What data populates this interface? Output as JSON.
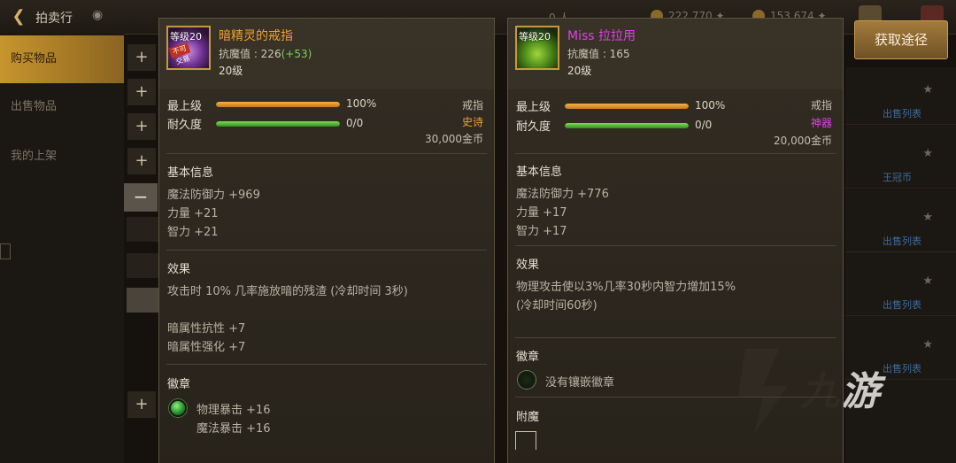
{
  "topbar": {
    "title": "拍卖行",
    "ghost1": "0 人",
    "ghost2": "222,770 ✦",
    "ghost3": "153,674 ✦"
  },
  "sidebar": {
    "items": [
      {
        "label": "购买物品"
      },
      {
        "label": "出售物品"
      },
      {
        "label": "我的上架"
      }
    ]
  },
  "obtain_button": {
    "label": "获取途径"
  },
  "right_list": {
    "items": [
      "出售列表",
      "王冠币",
      "出售列表",
      "出售列表",
      "出售列表"
    ]
  },
  "watermark": {
    "text": "九游"
  },
  "left_item": {
    "badge": "等级20",
    "lock": "不可交易",
    "name": "暗精灵的戒指",
    "name_color": "#f0a030",
    "stat_label": "抗魔值 : 226",
    "stat_bonus": "(+53)",
    "level": "20级",
    "bar1_label": "最上级",
    "bar1_value": "100%",
    "bar1_fill": 1.0,
    "bar2_label": "耐久度",
    "bar2_value": "0/0",
    "bar2_fill": 1.0,
    "type": "戒指",
    "rarity": "史诗",
    "rarity_color": "#f0a030",
    "price": "30,000金币",
    "basic_title": "基本信息",
    "basic": [
      "魔法防御力 +969",
      "力量 +21",
      "智力 +21"
    ],
    "effect_title": "效果",
    "effect": "攻击时 10% 几率施放暗的残渣 (冷却时间 3秒)",
    "attrs": [
      "暗属性抗性 +7",
      "暗属性强化 +7"
    ],
    "emblem_title": "徽章",
    "emblems": [
      "物理暴击 +16",
      "魔法暴击 +16"
    ]
  },
  "right_item": {
    "badge": "等级20",
    "name": "Miss 拉拉用",
    "name_color": "#e040e8",
    "stat_label": "抗魔值 : 165",
    "level": "20级",
    "bar1_label": "最上级",
    "bar1_value": "100%",
    "bar1_fill": 1.0,
    "bar2_label": "耐久度",
    "bar2_value": "0/0",
    "bar2_fill": 1.0,
    "type": "戒指",
    "rarity": "神器",
    "rarity_color": "#e040e8",
    "price": "20,000金币",
    "basic_title": "基本信息",
    "basic": [
      "魔法防御力 +776",
      "力量 +17",
      "智力 +17"
    ],
    "effect_title": "效果",
    "effect_lines": [
      "物理攻击使以3%几率30秒内智力增加15%",
      "(冷却时间60秒)"
    ],
    "emblem_title": "徽章",
    "emblem_empty": "没有镶嵌徽章",
    "enchant_title": "附魔"
  }
}
